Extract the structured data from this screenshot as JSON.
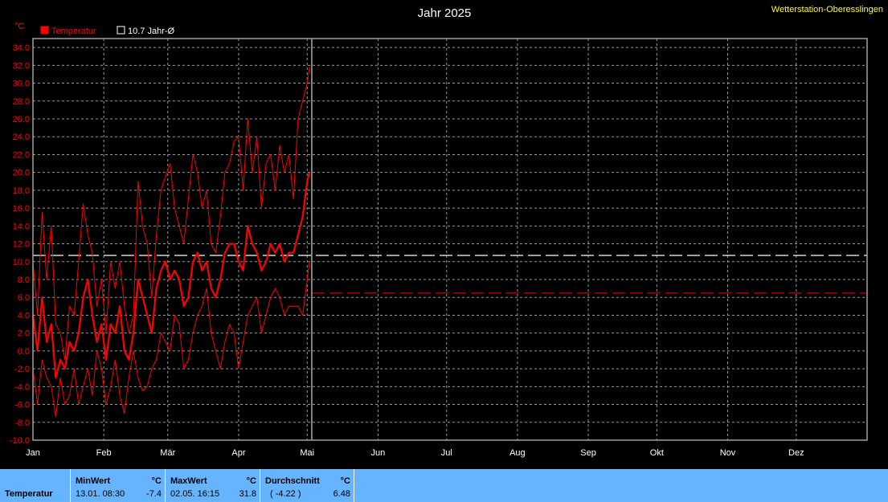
{
  "header": {
    "title": "Jahr 2025",
    "station": "Wetterstation-Oberesslingen",
    "unit": "°C"
  },
  "legend": [
    {
      "label": "Temperatur",
      "color": "#ff0000",
      "box_fill": "#ff0000",
      "text_color": "#ff0000"
    },
    {
      "label": "10.7 Jahr-Ø",
      "color": "#ffffff",
      "box_fill": "#000000",
      "text_color": "#ffffff"
    }
  ],
  "chart_data": {
    "type": "line",
    "title": "Jahr 2025",
    "ylabel": "°C",
    "ylim": [
      -10,
      35
    ],
    "xlim": [
      0,
      365
    ],
    "yticks": [
      "34.0",
      "32.0",
      "30.0",
      "28.0",
      "26.0",
      "24.0",
      "22.0",
      "20.0",
      "18.0",
      "16.0",
      "14.0",
      "12.0",
      "10.0",
      "8.0",
      "6.0",
      "4.0",
      "2.0",
      "0.0",
      "-2.0",
      "-4.0",
      "-6.0",
      "-8.0",
      "-10.0"
    ],
    "months": [
      "Jan",
      "Feb",
      "Mär",
      "Apr",
      "Mai",
      "Jun",
      "Jul",
      "Aug",
      "Sep",
      "Okt",
      "Nov",
      "Dez"
    ],
    "month_starts": [
      0,
      31,
      59,
      90,
      120,
      151,
      181,
      212,
      243,
      273,
      304,
      334
    ],
    "grid": true,
    "colors": {
      "grid": "#999999",
      "axis": "#a0a0a0",
      "tick_text": "#ff0000",
      "month_text": "#ffffff",
      "series": "#ff0000",
      "mean_line": "#ffffff",
      "avg_line": "#cc0000",
      "today": "#aaaaaa"
    },
    "long_term_mean": 10.7,
    "year_average": 6.48,
    "current_day": 122,
    "series": [
      {
        "role": "max",
        "x": [
          0,
          2,
          4,
          6,
          8,
          10,
          12,
          14,
          16,
          18,
          20,
          22,
          24,
          26,
          28,
          30,
          32,
          34,
          36,
          38,
          40,
          42,
          44,
          46,
          48,
          50,
          52,
          54,
          56,
          58,
          60,
          62,
          64,
          66,
          68,
          70,
          72,
          74,
          76,
          78,
          80,
          82,
          84,
          86,
          88,
          90,
          92,
          94,
          96,
          98,
          100,
          102,
          104,
          106,
          108,
          110,
          112,
          114,
          116,
          118,
          120,
          121
        ],
        "values": [
          10,
          4,
          15.5,
          8,
          14,
          3,
          2,
          -1,
          5,
          4,
          10,
          16.5,
          13,
          11,
          5,
          8,
          2,
          10,
          7,
          10,
          5,
          2,
          4,
          19,
          14,
          12,
          6,
          13,
          18,
          19.5,
          21,
          16,
          14,
          12,
          17,
          22,
          20,
          16,
          18,
          12,
          11,
          15,
          20,
          21,
          23.5,
          24,
          18,
          26,
          20,
          24,
          16,
          21,
          22,
          18,
          23,
          20,
          22,
          17,
          26,
          28,
          30,
          31.8
        ]
      },
      {
        "role": "min",
        "x": [
          0,
          2,
          4,
          6,
          8,
          10,
          12,
          14,
          16,
          18,
          20,
          22,
          24,
          26,
          28,
          30,
          32,
          34,
          36,
          38,
          40,
          42,
          44,
          46,
          48,
          50,
          52,
          54,
          56,
          58,
          60,
          62,
          64,
          66,
          68,
          70,
          72,
          74,
          76,
          78,
          80,
          82,
          84,
          86,
          88,
          90,
          92,
          94,
          96,
          98,
          100,
          102,
          104,
          106,
          108,
          110,
          112,
          114,
          116,
          118,
          120,
          121
        ],
        "values": [
          -2,
          -6,
          -1,
          -3,
          -4,
          -7.4,
          -3,
          -6,
          -5,
          -2,
          -6,
          -4,
          -2,
          -5,
          0,
          -2,
          -6,
          -4,
          -1,
          -5,
          -7,
          -3,
          0,
          -3,
          -4.5,
          -4,
          -2,
          -1,
          2,
          1,
          0,
          4,
          3,
          -2,
          -1,
          2,
          4,
          5,
          7,
          2,
          0,
          -2,
          1,
          3,
          2,
          -2,
          1,
          4,
          5,
          6,
          2,
          4,
          6,
          7,
          6,
          4,
          5,
          5,
          5,
          4,
          8,
          10
        ]
      },
      {
        "role": "mean",
        "x": [
          0,
          2,
          4,
          6,
          8,
          10,
          12,
          14,
          16,
          18,
          20,
          22,
          24,
          26,
          28,
          30,
          32,
          34,
          36,
          38,
          40,
          42,
          44,
          46,
          48,
          50,
          52,
          54,
          56,
          58,
          60,
          62,
          64,
          66,
          68,
          70,
          72,
          74,
          76,
          78,
          80,
          82,
          84,
          86,
          88,
          90,
          92,
          94,
          96,
          98,
          100,
          102,
          104,
          106,
          108,
          110,
          112,
          114,
          116,
          118,
          120,
          121
        ],
        "values": [
          4,
          0,
          6,
          1,
          3,
          -3,
          -1,
          -2,
          1,
          0,
          2,
          6,
          8,
          4,
          1,
          3,
          -1,
          3,
          2,
          5,
          0,
          -1,
          2,
          8,
          6,
          4,
          2,
          7,
          9,
          10,
          8,
          9,
          8,
          5,
          6,
          10,
          11,
          9,
          10,
          7,
          6,
          8,
          11,
          12,
          12,
          10,
          9,
          14,
          12,
          11,
          9,
          10,
          12,
          11,
          12,
          10,
          11,
          11,
          13,
          15,
          19,
          20
        ]
      }
    ]
  },
  "stats": {
    "row_label": "Temperatur",
    "min": {
      "header": "MinWert",
      "unit": "°C",
      "datetime": "13.01.  08:30",
      "value": "-7.4"
    },
    "max": {
      "header": "MaxWert",
      "unit": "°C",
      "datetime": "02.05.  16:15",
      "value": "31.8"
    },
    "avg": {
      "header": "Durchschnitt",
      "unit": "°C",
      "deviation": "( -4.22 )",
      "value": "6.48"
    }
  }
}
